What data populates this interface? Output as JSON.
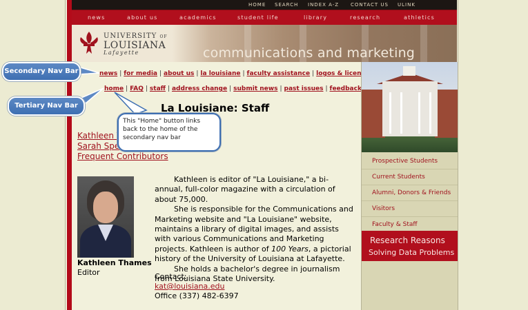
{
  "utility_nav": [
    "HOME",
    "SEARCH",
    "INDEX A-Z",
    "CONTACT US",
    "ULINK"
  ],
  "main_nav": [
    "news",
    "about us",
    "academics",
    "student life",
    "library",
    "research",
    "athletics"
  ],
  "logo": {
    "line1": "UNIVERSITY",
    "line1b": "OF",
    "line2": "LOUISIANA",
    "line3": "Lafayette"
  },
  "banner_title": "communications and marketing",
  "secondary_nav": [
    "news",
    "for media",
    "about us",
    "la louisiane",
    "faculty assistance",
    "logos & licensing"
  ],
  "tertiary_nav": [
    "home",
    "FAQ",
    "staff",
    "address change",
    "submit news",
    "past issues",
    "feedback"
  ],
  "page_title": "La Louisiane: Staff",
  "staff_links": [
    "Kathleen Thames",
    "Sarah Spell",
    "Frequent Contributors"
  ],
  "staff_links_visible": [
    "Kathleen T",
    "Sarah Spell",
    "Frequent Contributors"
  ],
  "profile": {
    "name": "Kathleen Thames",
    "role": "Editor",
    "bio_p1": "Kathleen is editor of \"La Louisiane,\" a bi-annual, full-color magazine with a circulation of about 75,000.",
    "bio_p2a": "She is responsible for the Communications and Marketing website and \"La Louisiane\" website, maintains a library of digital images, and assists with various Communications and Marketing projects. Kathleen is author of ",
    "bio_p2_italic": "100 Years",
    "bio_p2b": ", a pictorial history of the University of Louisiana at Lafayette.",
    "bio_p3": "She holds a bachelor's degree in journalism from Louisiana State University.",
    "contact_label": "Contact:",
    "email": "kat@louisiana.edu",
    "office": "Office (337) 482-6397"
  },
  "sidebar_menu": [
    "Prospective Students",
    "Current Students",
    "Alumni, Donors & Friends",
    "Visitors",
    "Faculty & Staff"
  ],
  "research_banner": {
    "line1": "Research Reasons",
    "line2": "Solving Data Problems"
  },
  "annotations": {
    "secondary": "Secondary Nav Bar",
    "tertiary": "Tertiary Nav Bar",
    "home_note": "This \"Home\" button links back to the home of the secondary nav bar"
  },
  "colors": {
    "brand_red": "#b10f1d",
    "link_red": "#a0121e",
    "callout_blue": "#3e6fb2"
  }
}
